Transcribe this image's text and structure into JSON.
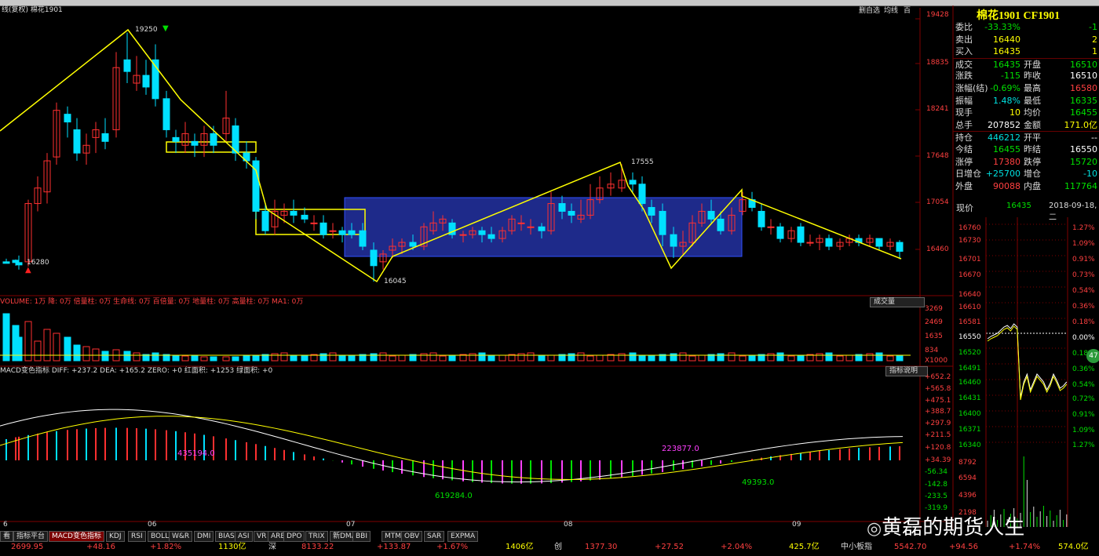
{
  "header": {
    "chart_title": "线(复权)  棉花1901",
    "right_buttons": [
      "删自选",
      "均线",
      "百"
    ]
  },
  "quote": {
    "title": "棉花1901 CF1901",
    "rows": [
      {
        "label": "委比",
        "v1": "-33.33%",
        "v2": "-1",
        "c1": "#00e000",
        "c2": "#00e000"
      },
      {
        "label": "卖出",
        "v1": "16440",
        "v2": "2",
        "c1": "#ffff00",
        "c2": "#ffff00"
      },
      {
        "label": "买入",
        "v1": "16435",
        "v2": "1",
        "c1": "#ffff00",
        "c2": "#ffff00"
      },
      {
        "label": "成交",
        "v1": "16435",
        "l2": "开盘",
        "v2": "16510",
        "c1": "#00e000",
        "c2": "#00e000"
      },
      {
        "label": "涨跌",
        "v1": "-115",
        "l2": "昨收",
        "v2": "16510",
        "c1": "#00e000",
        "c2": "#ffffff"
      },
      {
        "label": "涨幅(结)",
        "v1": "-0.69%",
        "l2": "最高",
        "v2": "16580",
        "c1": "#00e000",
        "c2": "#ff4040"
      },
      {
        "label": "振幅",
        "v1": "1.48%",
        "l2": "最低",
        "v2": "16335",
        "c1": "#00e0e0",
        "c2": "#00e000"
      },
      {
        "label": "现手",
        "v1": "10",
        "l2": "均价",
        "v2": "16455",
        "c1": "#ffff00",
        "c2": "#00e000"
      },
      {
        "label": "总手",
        "v1": "207852",
        "l2": "金额",
        "v2": "171.0亿",
        "c1": "#ffffff",
        "c2": "#ffff00"
      },
      {
        "label": "持仓",
        "v1": "446212",
        "l2": "开平",
        "v2": "--",
        "c1": "#00e0e0",
        "c2": "#ffffff"
      },
      {
        "label": "今结",
        "v1": "16455",
        "l2": "昨结",
        "v2": "16550",
        "c1": "#00e000",
        "c2": "#ffffff"
      },
      {
        "label": "涨停",
        "v1": "17380",
        "l2": "跌停",
        "v2": "15720",
        "c1": "#ff4040",
        "c2": "#00e000"
      },
      {
        "label": "日增仓",
        "v1": "+25700",
        "l2": "增仓",
        "v2": "-10",
        "c1": "#00e0e0",
        "c2": "#00e0e0"
      },
      {
        "label": "外盘",
        "v1": "90088",
        "l2": "内盘",
        "v2": "117764",
        "c1": "#ff4040",
        "c2": "#00e000"
      }
    ],
    "current_label": "现价",
    "current_value": "16435",
    "date": "2018-09-18,二"
  },
  "price_axis": [
    "19428",
    "18835",
    "18241",
    "17648",
    "17054",
    "16460"
  ],
  "annotations": {
    "high": "19250",
    "low_left": "16280",
    "low_mid": "16045",
    "peak_aug": "17555"
  },
  "volume": {
    "legend": "VOLUME: 1万  降: 0万  倍量柱: 0万  生命线: 0万  百倍量: 0万  地量柱: 0万  高量柱: 0万  MA1: 0万",
    "button": "成交量",
    "axis": [
      "3269",
      "2469",
      "1635",
      "834",
      "X1000"
    ]
  },
  "macd": {
    "legend": "MACD变色指标  DIFF: +237.2  DEA: +165.2  ZERO: +0  红面积: +1253  绿面积: +0",
    "button": "指标说明",
    "axis": [
      "+652.2",
      "+565.8",
      "+475.1",
      "+388.7",
      "+297.9",
      "+211.5",
      "+120.8",
      "+34.39",
      "-56.34",
      "-142.8",
      "-233.5",
      "-319.9"
    ],
    "area_labels": [
      "435194.0",
      "619284.0",
      "223877.0",
      "49393.0"
    ]
  },
  "month_labels": [
    "6",
    "06",
    "07",
    "08",
    "09"
  ],
  "intraday_axis_left": [
    "16760",
    "16730",
    "16701",
    "16670",
    "16640",
    "16610",
    "16581",
    "16550",
    "16520",
    "16491",
    "16460",
    "16431",
    "16400",
    "16371",
    "16340",
    "8792",
    "6594",
    "4396",
    "2198"
  ],
  "intraday_axis_right": [
    "1.27%",
    "1.09%",
    "0.91%",
    "0.73%",
    "0.54%",
    "0.36%",
    "0.18%",
    "0.00%",
    "0.18%",
    "0.36%",
    "0.54%",
    "0.72%",
    "0.91%",
    "1.09%",
    "1.27%"
  ],
  "tabs": [
    "看",
    "指标平台",
    "MACD变色指标",
    "KDJ",
    "RSI",
    "BOLL",
    "W&R",
    "DMI",
    "BIAS",
    "ASI",
    "VR",
    "ARBR",
    "DPO",
    "TRIX",
    "新DMA",
    "BBI",
    "MTM",
    "OBV",
    "SAR",
    "EXPMA"
  ],
  "index_bar": [
    "2699.95",
    "+48.16",
    "+1.82%",
    "1130亿",
    "深",
    "8133.22",
    "+133.87",
    "+1.67%",
    "1406亿",
    "创",
    "1377.30",
    "+27.52",
    "+2.04%",
    "425.7亿",
    "中小板指",
    "5542.70",
    "+94.56",
    "+1.74%",
    "574.0亿"
  ],
  "watermark": "黄磊的期货人生",
  "colors": {
    "up": "#ff3030",
    "down": "#00e0ff",
    "line": "#ffff00",
    "box": "#1e2a8a"
  }
}
